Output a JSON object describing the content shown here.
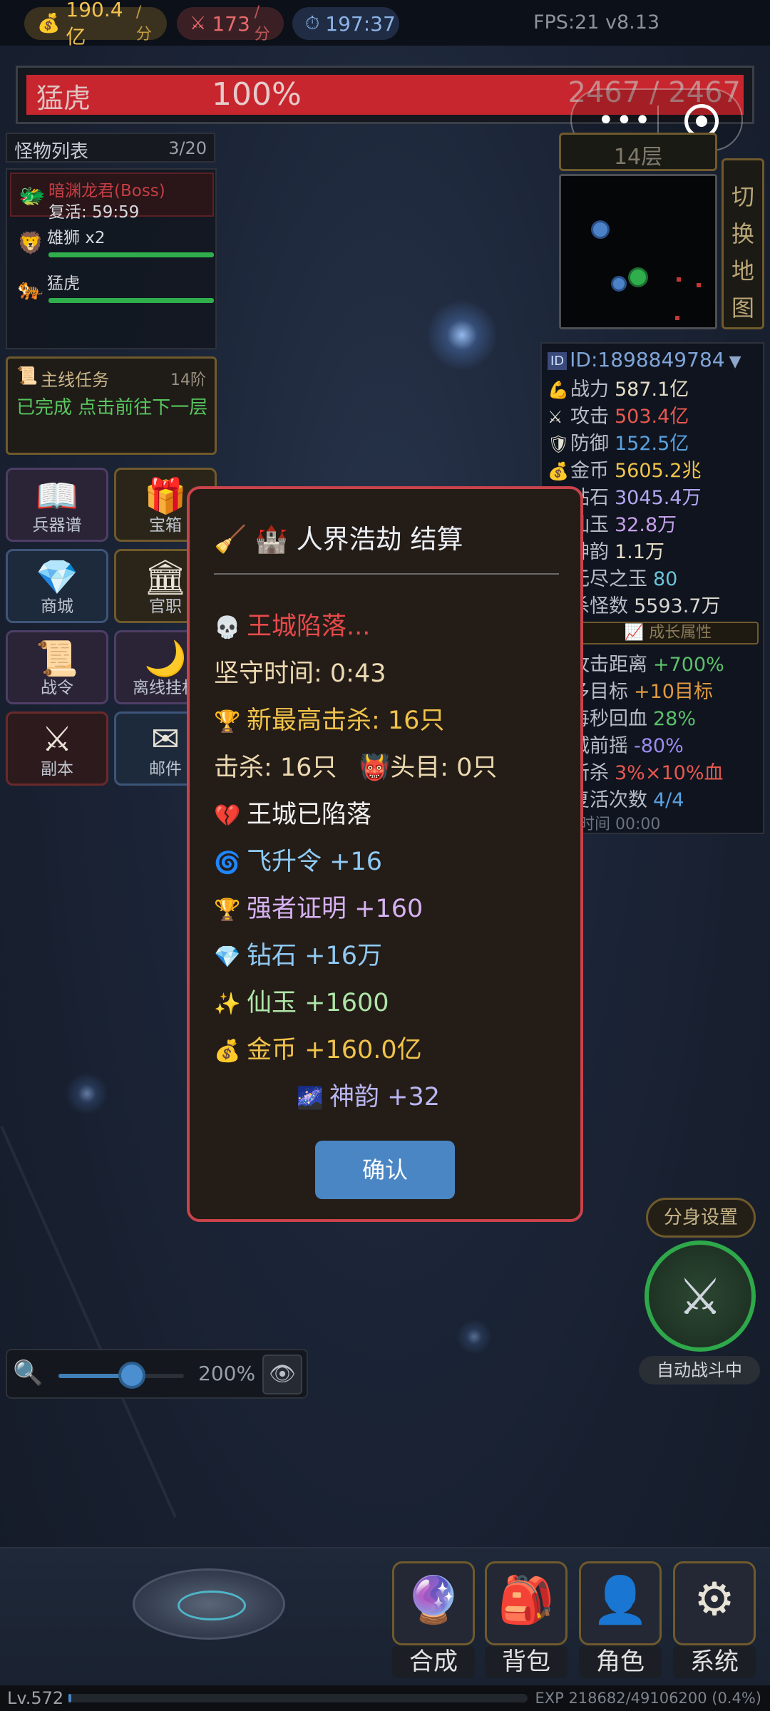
{
  "topbar": {
    "gold_rate": "190.4亿",
    "gold_unit": "/分",
    "kill_rate": "173",
    "kill_unit": "/分",
    "timer": "197:37",
    "fps_version": "FPS:21 v8.13"
  },
  "boss_bar": {
    "name": "猛虎",
    "percent": "100%",
    "hp": "2467 / 2467",
    "fill_fraction": 1.0,
    "fill_color": "#c8262e"
  },
  "monster_list": {
    "title": "怪物列表",
    "count": "3/20",
    "items": [
      {
        "icon": "dragon-icon",
        "name": "暗渊龙君(Boss)",
        "status": "复活: 59:59"
      },
      {
        "icon": "lion-icon",
        "name": "雄狮 x2"
      },
      {
        "icon": "tiger-icon",
        "name": "猛虎"
      }
    ]
  },
  "quest": {
    "title": "主线任务",
    "stage": "14阶",
    "desc": "已完成 点击前往下一层"
  },
  "menu": [
    {
      "label": "兵器谱",
      "icon": "book-icon"
    },
    {
      "label": "宝箱",
      "icon": "gift-box-icon"
    },
    {
      "label": "商城",
      "icon": "diamond-icon"
    },
    {
      "label": "官职",
      "icon": "temple-icon"
    },
    {
      "label": "战令",
      "icon": "scroll-icon"
    },
    {
      "label": "离线挂机",
      "icon": "moon-icon"
    },
    {
      "label": "副本",
      "icon": "crossed-swords-icon"
    },
    {
      "label": "邮件",
      "icon": "mail-icon"
    }
  ],
  "map": {
    "floor": "14层",
    "switch_label": [
      "切",
      "换",
      "地",
      "图"
    ]
  },
  "stats": {
    "id": "ID:1898849784",
    "rows": [
      {
        "label": "战力",
        "value": "587.1亿",
        "icon": "muscle-icon"
      },
      {
        "label": "攻击",
        "value": "503.4亿",
        "icon": "swords-icon"
      },
      {
        "label": "防御",
        "value": "152.5亿",
        "icon": "shield-icon"
      },
      {
        "label": "金币",
        "value": "5605.2兆",
        "icon": "money-bag-icon"
      },
      {
        "label": "钻石",
        "value": "3045.4万",
        "icon": "diamond-icon"
      },
      {
        "label": "仙玉",
        "value": "32.8万",
        "icon": "sparkle-icon"
      },
      {
        "label": "神韵",
        "value": "1.1万",
        "icon": "star-icon"
      },
      {
        "label": "无尽之玉",
        "value": "80",
        "icon": "jade-icon"
      },
      {
        "label": "杀怪数",
        "value": "5593.7万",
        "icon": "skull-icon"
      }
    ],
    "growth_label": "成长属性",
    "growth_rows": [
      {
        "label": "攻击距离",
        "value": "+700%"
      },
      {
        "label": "多目标",
        "value": "+10目标"
      },
      {
        "label": "每秒回血",
        "value": "28%"
      },
      {
        "label": "减前摇",
        "value": "-80%"
      },
      {
        "label": "斩杀",
        "value": "3%×10%血"
      },
      {
        "label": "复活次数",
        "value": "4/4"
      }
    ],
    "revive_time": "复活时间 00:00"
  },
  "modal": {
    "title": "人界浩劫 结算",
    "fallen": "王城陷落...",
    "hold_time": "坚守时间: 0:43",
    "new_record": "新最高击杀: 16只",
    "kills": "击杀: 16只",
    "bosses": "头目: 0只",
    "city_fallen": "王城已陷落",
    "rewards": [
      {
        "icon": "swirl-icon",
        "text": "飞升令 +16"
      },
      {
        "icon": "trophy-icon",
        "text": "强者证明 +160"
      },
      {
        "icon": "diamond-icon",
        "text": "钻石 +16万"
      },
      {
        "icon": "sparkles-icon",
        "text": "仙玉 +1600"
      },
      {
        "icon": "money-bag-icon",
        "text": "金币 +160.0亿"
      },
      {
        "icon": "galaxy-icon",
        "text": "神韵 +32"
      }
    ],
    "confirm": "确认"
  },
  "controls": {
    "clone_settings": "分身设置",
    "auto_battle": "自动战斗中",
    "zoom_value": "200%",
    "zoom_level": 0.6
  },
  "bottom_nav": [
    {
      "label": "合成",
      "icon": "crystal-ball-icon"
    },
    {
      "label": "背包",
      "icon": "backpack-icon"
    },
    {
      "label": "角色",
      "icon": "person-icon"
    },
    {
      "label": "系统",
      "icon": "gear-icon"
    }
  ],
  "footer": {
    "level": "Lv.572",
    "exp": "EXP 218682/49106200 (0.4%)",
    "exp_fraction": 0.004
  }
}
